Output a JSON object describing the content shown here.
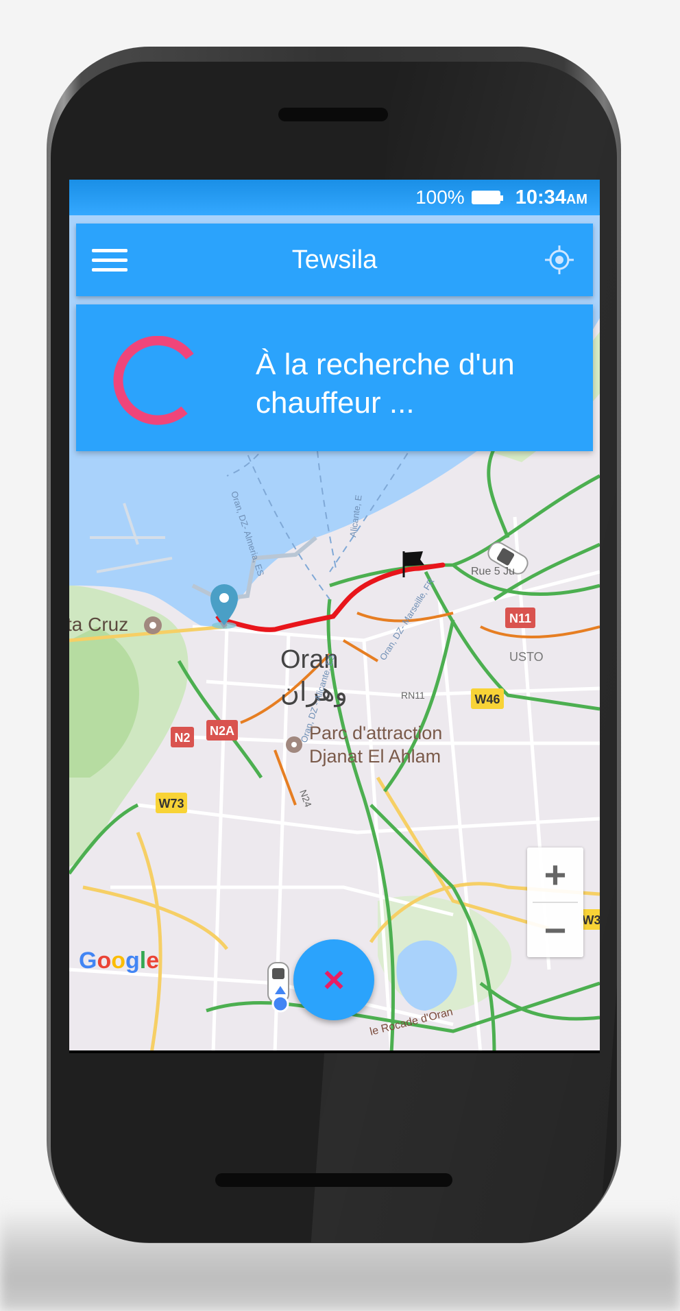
{
  "status_bar": {
    "battery_percent": "100%",
    "time": "10:34",
    "time_suffix": "AM",
    "icons": [
      "battery-full-icon"
    ]
  },
  "app_bar": {
    "title": "Tewsila",
    "menu_icon": "hamburger-menu-icon",
    "locate_icon": "gps-locate-icon"
  },
  "search_card": {
    "line1": "À la recherche d'un",
    "line2": "chauffeur ...",
    "spinner_color": "#f0457a"
  },
  "map": {
    "labels": {
      "city": "Oran",
      "city_ar": "وهران",
      "park_line1": "Parc d'attraction",
      "park_line2": "Djanat El Ahlam",
      "santa_cruz": "ta Cruz",
      "usto": "USTO",
      "rue": "Rue 5 Ju",
      "rn11": "RN11",
      "n24": "N24",
      "rocade": "le Rocade d'Oran",
      "ferry1": "Oran, DZ- Almeria, ES",
      "ferry2": "Alicante, E",
      "ferry3": "Oran, DZ- Marseille, FR",
      "ferry4": "Oran, DZ - Alicante, ES"
    },
    "road_shields": {
      "n11": "N11",
      "w46": "W46",
      "n2": "N2",
      "n2a": "N2A",
      "w73": "W73",
      "w3": "W3"
    },
    "google": "Google",
    "zoom_in": "+",
    "zoom_out": "−",
    "route_color": "#e8151b",
    "water_color": "#a9d2fb"
  },
  "cancel_button": {
    "label": "×",
    "color": "#2ba3fc"
  },
  "nav": {
    "back_icon": "back-triangle-icon",
    "home_icon": "home-circle-icon",
    "recents_icon": "recents-square-icon"
  }
}
